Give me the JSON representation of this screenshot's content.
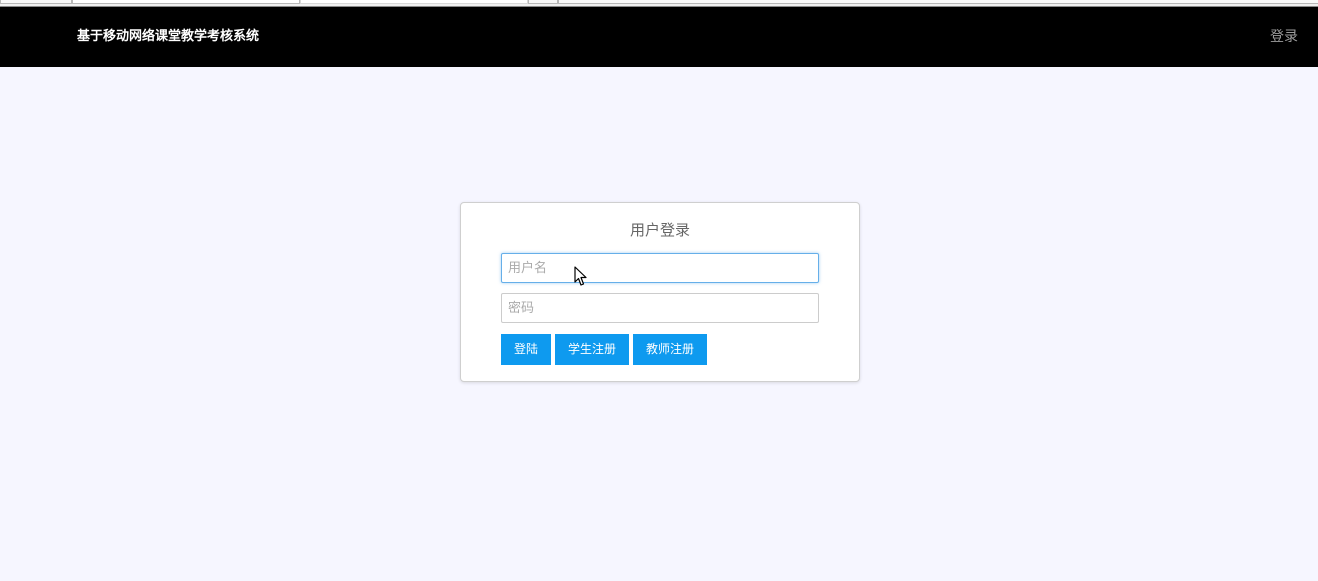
{
  "navbar": {
    "brand": "基于移动网络课堂教学考核系统",
    "login_link": "登录"
  },
  "login": {
    "title": "用户登录",
    "username": {
      "placeholder": "用户名",
      "value": ""
    },
    "password": {
      "placeholder": "密码",
      "value": ""
    },
    "buttons": {
      "login": "登陆",
      "student_register": "学生注册",
      "teacher_register": "教师注册"
    }
  },
  "colors": {
    "navbar_bg": "#000000",
    "page_bg": "#f6f6ff",
    "button_bg": "#0e9aef",
    "focus_border": "#66afe9"
  },
  "icons": {
    "cursor": "mouse-pointer-icon"
  }
}
